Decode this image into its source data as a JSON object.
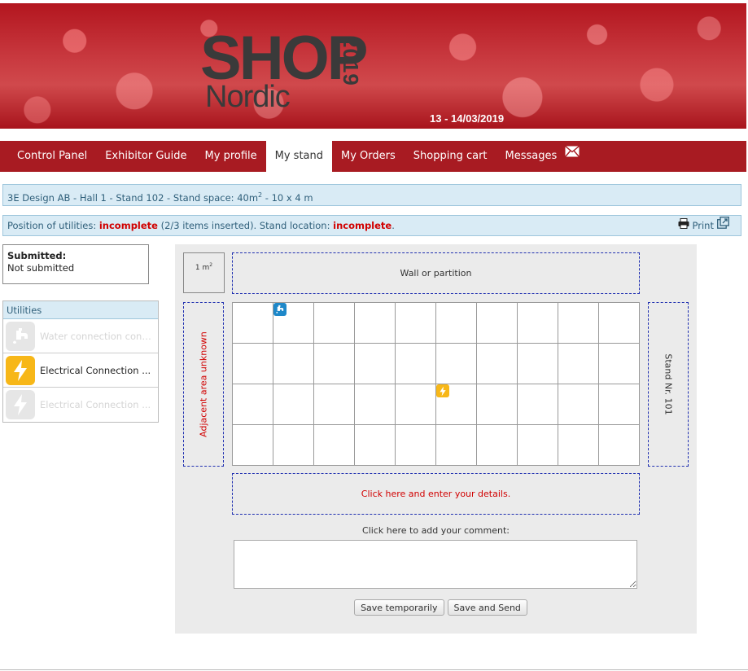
{
  "banner": {
    "logo_shop": "SHOP",
    "logo_year": "2019",
    "logo_nordic": "Nordic",
    "dates": "13 - 14/03/2019"
  },
  "nav": {
    "items": [
      {
        "label": "Control Panel"
      },
      {
        "label": "Exhibitor Guide"
      },
      {
        "label": "My profile"
      },
      {
        "label": "My stand",
        "active": true
      },
      {
        "label": "My Orders"
      },
      {
        "label": "Shopping cart"
      },
      {
        "label": "Messages"
      }
    ]
  },
  "stand_info": {
    "prefix": "3E Design AB - Hall 1 - Stand 102 - Stand space: 40m",
    "sup": "2",
    "suffix": " - 10 x 4 m"
  },
  "status_bar": {
    "t1": "Position of utilities: ",
    "utilities_status": "incomplete",
    "t2": " (2/3 items inserted). Stand location: ",
    "location_status": "incomplete",
    "t3": ".",
    "print_label": "Print"
  },
  "submission": {
    "label": "Submitted:",
    "value": "Not submitted"
  },
  "utilities": {
    "header": "Utilities",
    "items": [
      {
        "label": "Water connection consi...",
        "icon": "water-tap-icon",
        "placed": true
      },
      {
        "label": "Electrical Connection ...",
        "icon": "lightning-icon",
        "placed": false
      },
      {
        "label": "Electrical Connection ...",
        "icon": "lightning-icon",
        "placed": true
      }
    ]
  },
  "editor": {
    "sqm": "1 m",
    "sqm_sup": "2",
    "wall": "Wall or partition",
    "adjacent": "Adjacent area unknown",
    "neighbor": "Stand Nr. 101",
    "details": "Click here and enter your details.",
    "comment_label": "Click here to add your comment:",
    "comment_value": "",
    "save_temp": "Save temporarily",
    "save_send": "Save and Send",
    "grid": {
      "cols": 10,
      "rows": 4
    },
    "placed_items": [
      {
        "type": "water",
        "row": 0,
        "col": 1
      },
      {
        "type": "electrical",
        "row": 2,
        "col": 5
      }
    ]
  },
  "colors": {
    "brand_red": "#a81b22",
    "info_bg": "#d9ebf5",
    "status_red": "#d10000",
    "water_blue": "#1e88c9",
    "electric_yellow": "#f7b718"
  }
}
